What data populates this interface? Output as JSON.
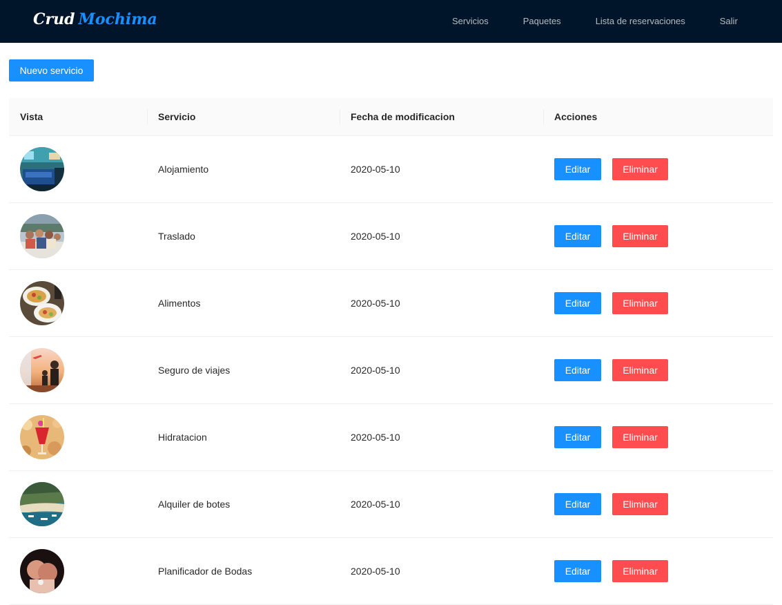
{
  "header": {
    "brand_part1": "Crud",
    "brand_part2": "Mochima",
    "nav": [
      {
        "label": "Servicios"
      },
      {
        "label": "Paquetes"
      },
      {
        "label": "Lista de reservaciones"
      },
      {
        "label": "Salir"
      }
    ]
  },
  "toolbar": {
    "new_label": "Nuevo servicio"
  },
  "table": {
    "columns": [
      "Vista",
      "Servicio",
      "Fecha de modificacion",
      "Acciones"
    ],
    "edit_label": "Editar",
    "delete_label": "Eliminar",
    "rows": [
      {
        "servicio": "Alojamiento",
        "fecha": "2020-05-10",
        "thumb": "hotel-room-photo"
      },
      {
        "servicio": "Traslado",
        "fecha": "2020-05-10",
        "thumb": "boat-group-photo"
      },
      {
        "servicio": "Alimentos",
        "fecha": "2020-05-10",
        "thumb": "seafood-plate-photo"
      },
      {
        "servicio": "Seguro de viajes",
        "fecha": "2020-05-10",
        "thumb": "airport-travelers-photo"
      },
      {
        "servicio": "Hidratacion",
        "fecha": "2020-05-10",
        "thumb": "cocktail-drink-photo"
      },
      {
        "servicio": "Alquiler de botes",
        "fecha": "2020-05-10",
        "thumb": "beach-boats-photo"
      },
      {
        "servicio": "Planificador de Bodas",
        "fecha": "2020-05-10",
        "thumb": "wedding-couple-photo"
      }
    ]
  },
  "colors": {
    "nav_bg": "#001529",
    "primary": "#1890ff",
    "danger": "#ff4d4f"
  }
}
